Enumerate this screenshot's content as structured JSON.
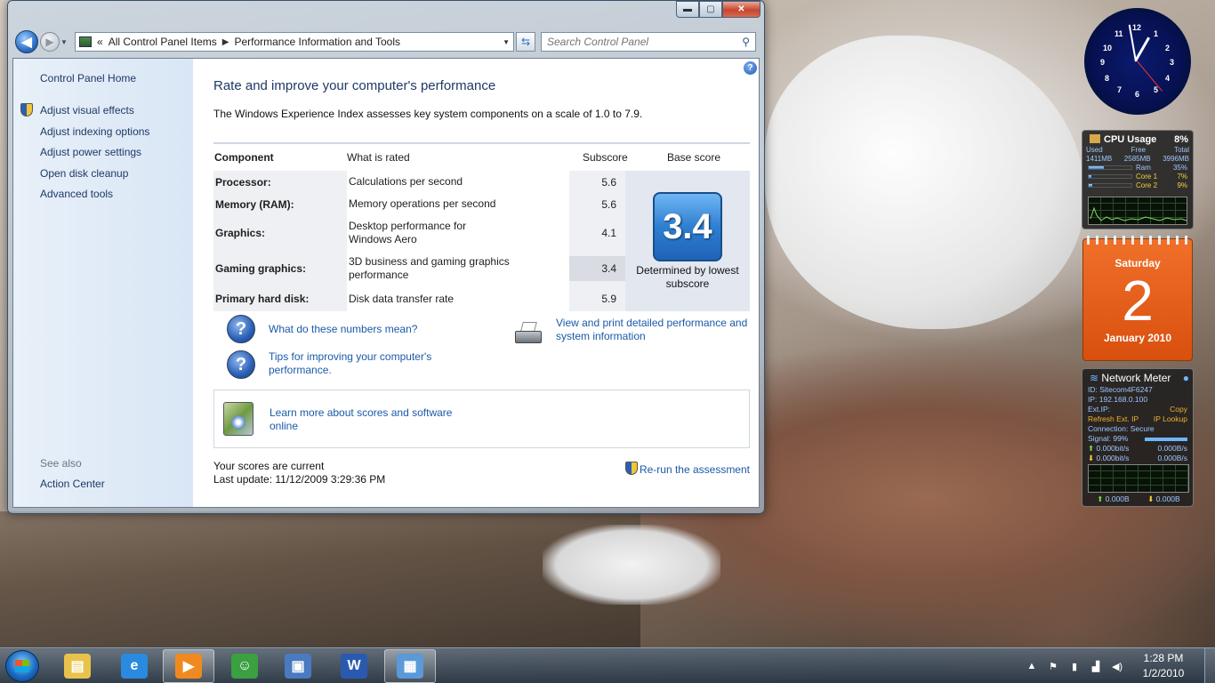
{
  "window": {
    "caption_min": "▬",
    "caption_max": "▢",
    "caption_close": "✕",
    "nav_back": "◀",
    "nav_forward": "▶",
    "nav_chevron": "«",
    "breadcrumb": [
      "All Control Panel Items",
      "Performance Information and Tools"
    ],
    "search_placeholder": "Search Control Panel"
  },
  "sidebar": {
    "home": "Control Panel Home",
    "links": [
      {
        "label": "Adjust visual effects",
        "shield": true
      },
      {
        "label": "Adjust indexing options",
        "shield": false
      },
      {
        "label": "Adjust power settings",
        "shield": false
      },
      {
        "label": "Open disk cleanup",
        "shield": false
      },
      {
        "label": "Advanced tools",
        "shield": false
      }
    ],
    "see_also": "See also",
    "action_center": "Action Center"
  },
  "main": {
    "help": "?",
    "title": "Rate and improve your computer's performance",
    "description": "The Windows Experience Index assesses key system components on a scale of 1.0 to 7.9.",
    "columns": {
      "component": "Component",
      "what": "What is rated",
      "subscore": "Subscore",
      "base": "Base score"
    },
    "rows": [
      {
        "component": "Processor:",
        "what": "Calculations per second",
        "subscore": "5.6"
      },
      {
        "component": "Memory (RAM):",
        "what": "Memory operations per second",
        "subscore": "5.6"
      },
      {
        "component": "Graphics:",
        "what": "Desktop performance for Windows Aero",
        "subscore": "4.1"
      },
      {
        "component": "Gaming graphics:",
        "what": "3D business and gaming graphics performance",
        "subscore": "3.4"
      },
      {
        "component": "Primary hard disk:",
        "what": "Disk data transfer rate",
        "subscore": "5.9"
      }
    ],
    "base_score": "3.4",
    "determined": "Determined by lowest subscore",
    "help_icon_glyph": "?",
    "link_numbers": "What do these numbers mean?",
    "link_tips": "Tips for improving your computer's performance.",
    "link_print": "View and print detailed performance and system information",
    "link_learn": "Learn more about scores and software online",
    "scores_current": "Your scores are current",
    "last_update": "Last update: 11/12/2009 3:29:36 PM",
    "rerun": "Re-run the assessment"
  },
  "gadgets": {
    "clock_numbers": [
      "12",
      "1",
      "2",
      "3",
      "4",
      "5",
      "6",
      "7",
      "8",
      "9",
      "10",
      "11"
    ],
    "cpu": {
      "title": "CPU Usage",
      "percent": "8%",
      "col_used": "Used",
      "col_free": "Free",
      "col_total": "Total",
      "used": "1411MB",
      "free": "2585MB",
      "total": "3996MB",
      "bars": [
        {
          "label": "Ram",
          "percent": "35%",
          "fraction": 0.35,
          "color": "#9cc8ff"
        },
        {
          "label": "Core 1",
          "percent": "7%",
          "fraction": 0.07,
          "color": "#f0d040"
        },
        {
          "label": "Core 2",
          "percent": "9%",
          "fraction": 0.09,
          "color": "#f0d040"
        }
      ]
    },
    "calendar": {
      "day": "Saturday",
      "date": "2",
      "month": "January 2010"
    },
    "network": {
      "title": "Network Meter",
      "id": "ID: Sitecom4F6247",
      "ip": "IP: 192.168.0.100",
      "ext_ip": "Ext.IP:",
      "copy": "Copy",
      "refresh": "Refresh Ext. IP",
      "lookup": "IP Lookup",
      "connection": "Connection: Secure",
      "signal": "Signal: 99%",
      "up_rate": "0.000bit/s",
      "up_bytes": "0.000B/s",
      "down_rate": "0.000bit/s",
      "down_bytes": "0.000B/s",
      "up_total": "0.000B",
      "down_total": "0.000B"
    }
  },
  "taskbar": {
    "apps": [
      {
        "name": "explorer",
        "glyph": "▤",
        "color": "#e8c24a"
      },
      {
        "name": "internet-explorer",
        "glyph": "e",
        "color": "#2a8ae0"
      },
      {
        "name": "media-player",
        "glyph": "▶",
        "color": "#f08a20"
      },
      {
        "name": "messenger",
        "glyph": "☺",
        "color": "#3aa040"
      },
      {
        "name": "remote-desktop",
        "glyph": "▣",
        "color": "#4a7ac0"
      },
      {
        "name": "word",
        "glyph": "W",
        "color": "#2a5ab0"
      },
      {
        "name": "control-panel",
        "glyph": "▦",
        "color": "#5a9ad8"
      }
    ],
    "time": "1:28 PM",
    "date": "1/2/2010"
  }
}
